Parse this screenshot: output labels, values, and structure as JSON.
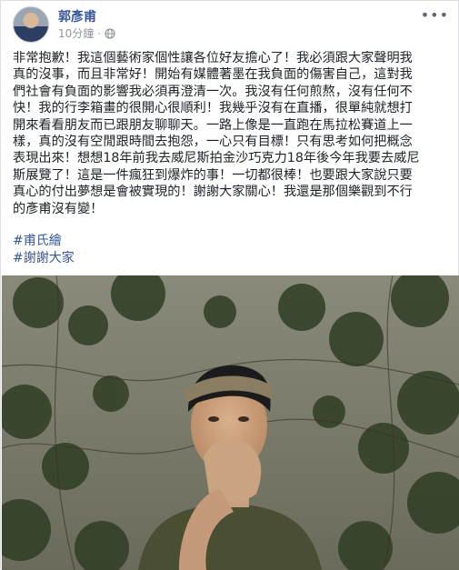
{
  "post": {
    "author": "郭彥甫",
    "time": "10分鐘",
    "privacy_icon": "globe-icon",
    "more_icon": "ellipsis-icon",
    "text_lines": [
      "非常抱歉！我這個藝術家個性讓各位好友擔心了！我必須跟大家聲明我",
      "真的沒事，而且非常好！開始有媒體著墨在我負面的傷害自己，這對我",
      "們社會有負面的影響我必須再澄清一次。我沒有任何煎熬，沒有任何不",
      "快！我的行李箱畫的很開心很順利！我幾乎沒有在直播，很單純就想打",
      "開來看看朋友而已跟朋友聊聊天。一路上像是一直跑在馬拉松賽道上一",
      "樣，真的沒有空閒跟時間去抱怨，一心只有目標！只有思考如何把概念",
      "表現出來！想想18年前我去威尼斯拍金沙巧克力18年後今年我要去威尼",
      "斯展覽了！這是一件瘋狂到爆炸的事！一切都很棒！也要跟大家說只要",
      "真心的付出夢想是會被實現的！謝謝大家關心！我還是那個樂觀到不行",
      "的彥甫沒有變！"
    ],
    "hashtags": [
      "#甫氏繪",
      "#謝謝大家"
    ]
  }
}
